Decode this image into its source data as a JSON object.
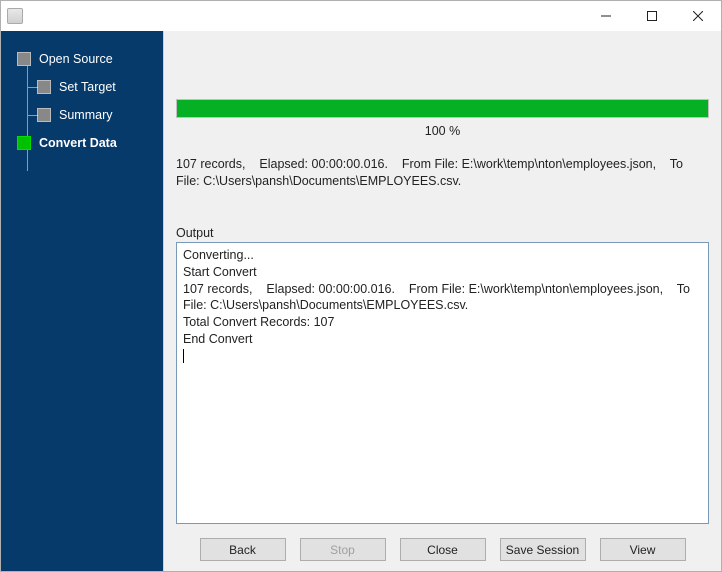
{
  "titlebar": {
    "title": ""
  },
  "sidebar": {
    "items": [
      {
        "label": "Open Source",
        "level": "root",
        "active": false
      },
      {
        "label": "Set Target",
        "level": "child",
        "active": false
      },
      {
        "label": "Summary",
        "level": "child",
        "active": false
      },
      {
        "label": "Convert Data",
        "level": "root",
        "active": true
      }
    ]
  },
  "progress": {
    "percent": 100,
    "percent_label": "100 %",
    "fill_width": "100%"
  },
  "status": {
    "text": "107 records,    Elapsed: 00:00:00.016.    From File: E:\\work\\temp\\nton\\employees.json,    To File: C:\\Users\\pansh\\Documents\\EMPLOYEES.csv."
  },
  "output": {
    "label": "Output",
    "lines": "Converting...\nStart Convert\n107 records,    Elapsed: 00:00:00.016.    From File: E:\\work\\temp\\nton\\employees.json,    To File: C:\\Users\\pansh\\Documents\\EMPLOYEES.csv.\nTotal Convert Records: 107\nEnd Convert"
  },
  "buttons": {
    "back": "Back",
    "stop": "Stop",
    "close": "Close",
    "save_session": "Save Session",
    "view": "View"
  }
}
